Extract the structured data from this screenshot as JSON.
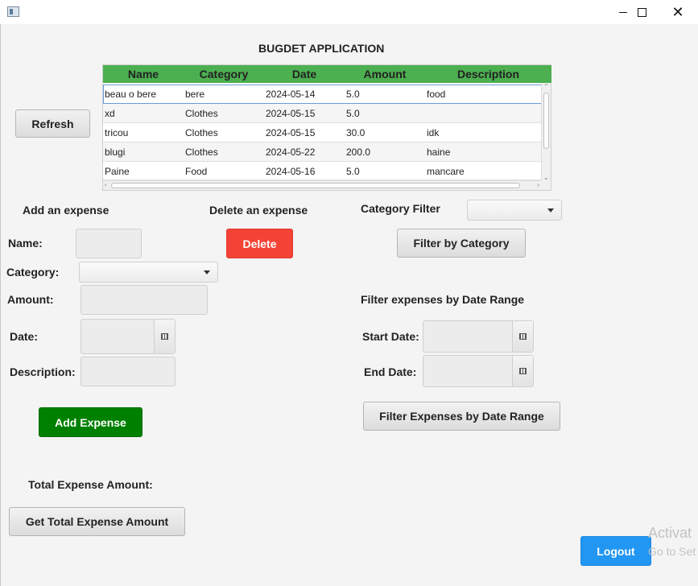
{
  "window": {
    "minimize_glyph": "",
    "maximize_glyph": "",
    "close_glyph": "✕"
  },
  "app_title": "BUGDET APPLICATION",
  "refresh_label": "Refresh",
  "table": {
    "columns": [
      "Name",
      "Category",
      "Date",
      "Amount",
      "Description"
    ],
    "rows": [
      [
        "beau o bere",
        "bere",
        "2024-05-14",
        "5.0",
        "food"
      ],
      [
        "xd",
        "Clothes",
        "2024-05-15",
        "5.0",
        ""
      ],
      [
        "tricou",
        "Clothes",
        "2024-05-15",
        "30.0",
        "idk"
      ],
      [
        "blugi",
        "Clothes",
        "2024-05-22",
        "200.0",
        "haine"
      ],
      [
        "Paine",
        "Food",
        "2024-05-16",
        "5.0",
        "mancare"
      ]
    ]
  },
  "add_section": {
    "heading": "Add an expense",
    "name_label": "Name:",
    "category_label": "Category:",
    "amount_label": "Amount:",
    "date_label": "Date:",
    "description_label": "Description:",
    "name_value": "",
    "category_value": "",
    "amount_value": "",
    "date_value": "",
    "description_value": "",
    "add_button": "Add Expense"
  },
  "delete_section": {
    "heading": "Delete an expense",
    "delete_button": "Delete"
  },
  "category_filter": {
    "label": "Category Filter",
    "selected": "",
    "button": "Filter by Category"
  },
  "date_filter": {
    "heading": "Filter expenses by Date Range",
    "start_label": "Start Date:",
    "end_label": "End Date:",
    "start_value": "",
    "end_value": "",
    "button": "Filter Expenses by Date Range"
  },
  "total": {
    "label": "Total Expense Amount:",
    "button": "Get Total Expense Amount"
  },
  "logout_label": "Logout",
  "watermark": {
    "line1": "Activat",
    "line2": "Go to Set"
  },
  "colors": {
    "table_header": "#4caf50",
    "delete_button": "#f44336",
    "add_button": "#008000",
    "logout_button": "#2196f3"
  }
}
